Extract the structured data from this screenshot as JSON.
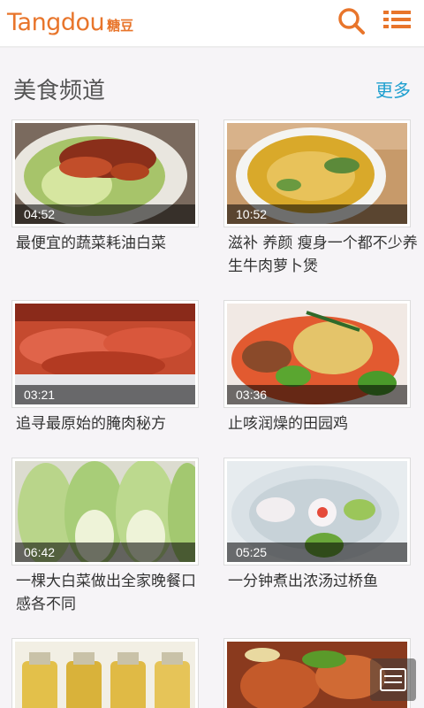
{
  "app": {
    "logo_latin": "Tangdou",
    "logo_cjk": "糖豆",
    "accent": "#e8752b"
  },
  "header": {
    "search_icon": "search-icon",
    "menu_icon": "menu-icon"
  },
  "section": {
    "title": "美食频道",
    "more": "更多",
    "more_color": "#1e9fcf"
  },
  "videos": [
    {
      "duration": "04:52",
      "title": "最便宜的蔬菜耗油白菜"
    },
    {
      "duration": "10:52",
      "title": "滋补 养颜 瘦身一个都不少养生牛肉萝卜煲"
    },
    {
      "duration": "03:21",
      "title": "追寻最原始的腌肉秘方"
    },
    {
      "duration": "03:36",
      "title": "止咳润燥的田园鸡"
    },
    {
      "duration": "06:42",
      "title": "一棵大白菜做出全家晚餐口感各不同"
    },
    {
      "duration": "05:25",
      "title": "一分钟煮出浓汤过桥鱼"
    },
    {
      "duration": "",
      "title": ""
    },
    {
      "duration": "",
      "title": ""
    }
  ]
}
